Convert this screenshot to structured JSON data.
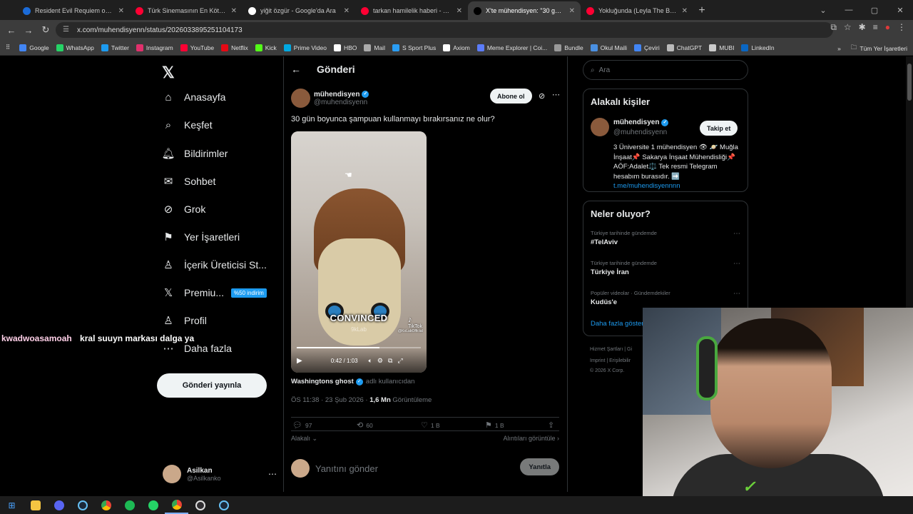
{
  "browser": {
    "tabs": [
      {
        "title": "Resident Evil Requiem on Steam",
        "color": "#1b6bd8",
        "active": false
      },
      {
        "title": "Türk Sinemasının En Kötü Filmi",
        "color": "#ff0033",
        "active": false
      },
      {
        "title": "yiğit özgür - Google'da Ara",
        "color": "#ffffff",
        "active": false
      },
      {
        "title": "tarkan hamilelik haberi - YouTube",
        "color": "#ff0033",
        "active": false
      },
      {
        "title": "X'te mühendisyen: \"30 gün boy",
        "color": "#000000",
        "active": true
      },
      {
        "title": "Yokluğunda (Leyla The Band) -",
        "color": "#ff0033",
        "active": false
      }
    ],
    "url": "x.com/muhendisyenn/status/2026033895251104173",
    "bookmarks": [
      "Google",
      "WhatsApp",
      "Twitter",
      "Instagram",
      "YouTube",
      "Netflix",
      "Kick",
      "Prime Video",
      "HBO",
      "Mail",
      "S Sport Plus",
      "Axiom",
      "Meme Explorer | Coi...",
      "Bundle",
      "Okul Maili",
      "Çeviri",
      "ChatGPT",
      "MUBI",
      "LinkedIn"
    ],
    "all_bookmarks": "Tüm Yer İşaretleri"
  },
  "nav": {
    "items": [
      {
        "label": "Anasayfa",
        "icon": "home-icon",
        "glyph": "⌂"
      },
      {
        "label": "Keşfet",
        "icon": "search-icon",
        "glyph": "⌕"
      },
      {
        "label": "Bildirimler",
        "icon": "bell-icon",
        "glyph": "🔔︎"
      },
      {
        "label": "Sohbet",
        "icon": "mail-icon",
        "glyph": "✉"
      },
      {
        "label": "Grok",
        "icon": "grok-icon",
        "glyph": "⊘"
      },
      {
        "label": "Yer İşaretleri",
        "icon": "bookmark-icon",
        "glyph": "⚑"
      },
      {
        "label": "İçerik Üreticisi St...",
        "icon": "creator-icon",
        "glyph": "♙"
      },
      {
        "label": "Premiu...",
        "icon": "x-premium-icon",
        "glyph": "𝕏",
        "badge": "%50 indirim"
      },
      {
        "label": "Profil",
        "icon": "profile-icon",
        "glyph": "♙"
      },
      {
        "label": "Daha fazla",
        "icon": "more-icon",
        "glyph": "⋯"
      }
    ],
    "post_button": "Gönderi yayınla",
    "account": {
      "name": "Asilkan",
      "handle": "@Asilkanko"
    }
  },
  "post": {
    "header": "Gönderi",
    "author": {
      "name": "mühendisyen",
      "handle": "@muhendisyenn"
    },
    "subscribe": "Abone ol",
    "text": "30 gün boyunca şampuan kullanmayı bırakırsanız ne olur?",
    "video": {
      "caption": "CONVINCED",
      "watermark": "TikTok",
      "watermark_user": "@KoLabOfficial",
      "center_mark": "9kLab",
      "time": "0:42 / 1:03",
      "progress": 0.667
    },
    "source_name": "Washingtons ghost",
    "source_suffix": "adlı kullanıcıdan",
    "timestamp": "ÖS 11:38 · 23 Şub 2026 ·",
    "views": "1,6 Mn",
    "views_label": "Görüntüleme",
    "metrics": {
      "replies": "97",
      "reposts": "60",
      "likes": "1 B",
      "bookmarks": "1 B"
    },
    "related": "Alakalı",
    "quotes": "Alıntıları görüntüle",
    "reply_placeholder": "Yanıtını gönder",
    "reply_button": "Yanıtla"
  },
  "sidebar": {
    "search_placeholder": "Ara",
    "people_title": "Alakalı kişiler",
    "person": {
      "name": "mühendisyen",
      "handle": "@muhendisyenn",
      "follow": "Takip et",
      "bio": "3 Üniversite 1 mühendisyen 👁‍ 🪐 Muğla İnşaat📌 Sakarya İnşaat Mühendisliği📌 AÖF:Adalet⚖️ Tek resmi Telegram hesabım burasıdır. ➡️",
      "link": "t.me/muhendisyennnn"
    },
    "trends_title": "Neler oluyor?",
    "trends": [
      {
        "context": "Türkiye tarihinde gündemde",
        "title": "#TelAviv"
      },
      {
        "context": "Türkiye tarihinde gündemde",
        "title": "Türkiye İran"
      },
      {
        "context": "Popüler videolar · Gündemdekiler",
        "title": "Kudüs'e"
      }
    ],
    "show_more": "Daha fazla göster",
    "footer": [
      "Hizmet Şartları  |  Gi",
      "Imprint  |  Erişilebilir",
      "© 2026 X Corp."
    ]
  },
  "overlay_chat": {
    "user": "kwadwoasamoah",
    "message": "kral suuyn markası dalga ya"
  }
}
